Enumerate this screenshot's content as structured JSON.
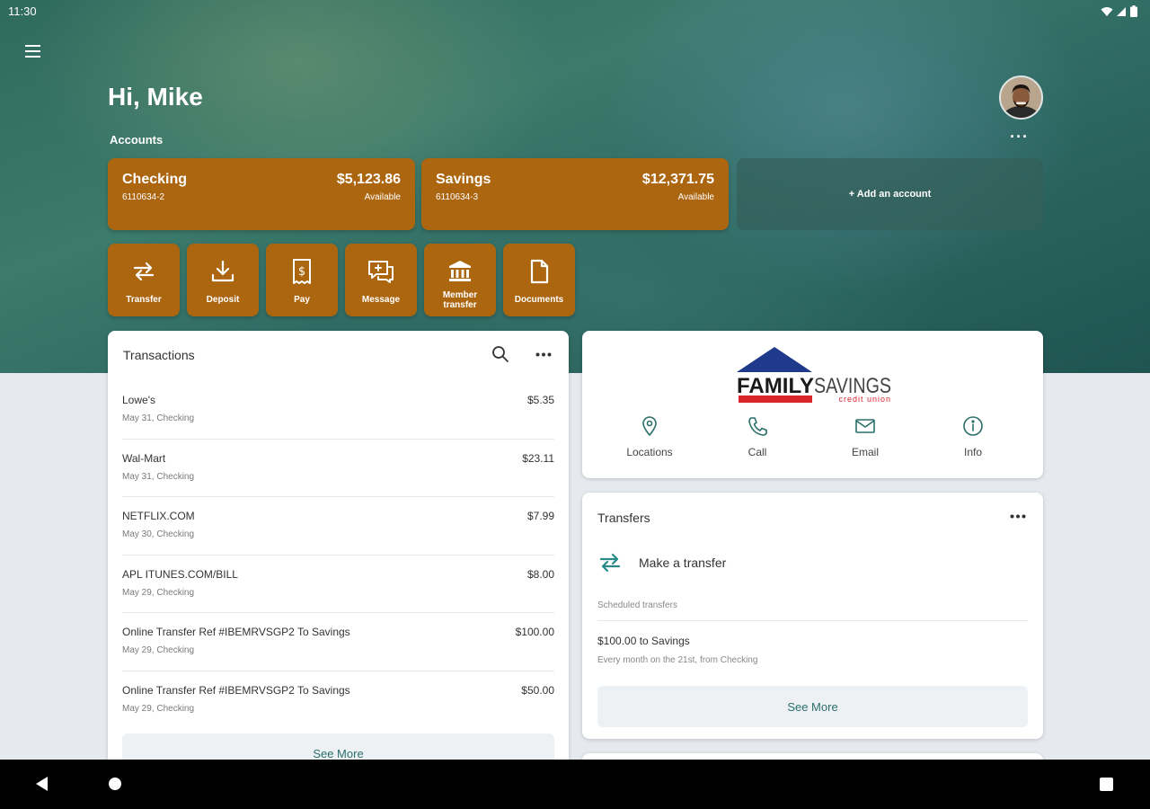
{
  "status_bar": {
    "time": "11:30"
  },
  "header": {
    "greeting": "Hi, Mike"
  },
  "accounts": {
    "label": "Accounts",
    "more_label": "···",
    "items": [
      {
        "name": "Checking",
        "number": "6110634-2",
        "balance": "$5,123.86",
        "balance_label": "Available"
      },
      {
        "name": "Savings",
        "number": "6110634-3",
        "balance": "$12,371.75",
        "balance_label": "Available"
      }
    ],
    "add_label": "+ Add an account"
  },
  "actions": [
    {
      "label": "Transfer",
      "icon": "transfer-icon"
    },
    {
      "label": "Deposit",
      "icon": "deposit-icon"
    },
    {
      "label": "Pay",
      "icon": "bill-pay-icon"
    },
    {
      "label": "Message",
      "icon": "message-icon"
    },
    {
      "label": "Member transfer",
      "icon": "bank-icon"
    },
    {
      "label": "Documents",
      "icon": "document-icon"
    }
  ],
  "transactions": {
    "title": "Transactions",
    "items": [
      {
        "name": "Lowe's",
        "sub": "May 31, Checking",
        "amount": "$5.35"
      },
      {
        "name": "Wal-Mart",
        "sub": "May 31, Checking",
        "amount": "$23.11"
      },
      {
        "name": "NETFLIX.COM",
        "sub": "May 30, Checking",
        "amount": "$7.99"
      },
      {
        "name": "APL ITUNES.COM/BILL",
        "sub": "May 29, Checking",
        "amount": "$8.00"
      },
      {
        "name": "Online Transfer Ref #IBEMRVSGP2 To Savings",
        "sub": "May 29, Checking",
        "amount": "$100.00"
      },
      {
        "name": "Online Transfer Ref #IBEMRVSGP2 To Savings",
        "sub": "May 29, Checking",
        "amount": "$50.00"
      }
    ],
    "see_more": "See More"
  },
  "brand": {
    "logo_text_1": "FAMILY",
    "logo_text_2": "SAVINGS",
    "logo_sub": "credit union",
    "links": [
      {
        "label": "Locations",
        "icon": "location-pin-icon"
      },
      {
        "label": "Call",
        "icon": "phone-icon"
      },
      {
        "label": "Email",
        "icon": "email-icon"
      },
      {
        "label": "Info",
        "icon": "info-icon"
      }
    ]
  },
  "transfers": {
    "title": "Transfers",
    "make_label": "Make a transfer",
    "scheduled_label": "Scheduled transfers",
    "scheduled": [
      {
        "title": "$100.00 to Savings",
        "sub": "Every month on the 21st, from Checking"
      }
    ],
    "see_more": "See More"
  },
  "colors": {
    "accent": "#ad6610",
    "teal": "#2a6f6a",
    "logo_blue": "#1f3a8a",
    "logo_red": "#d8262c"
  }
}
